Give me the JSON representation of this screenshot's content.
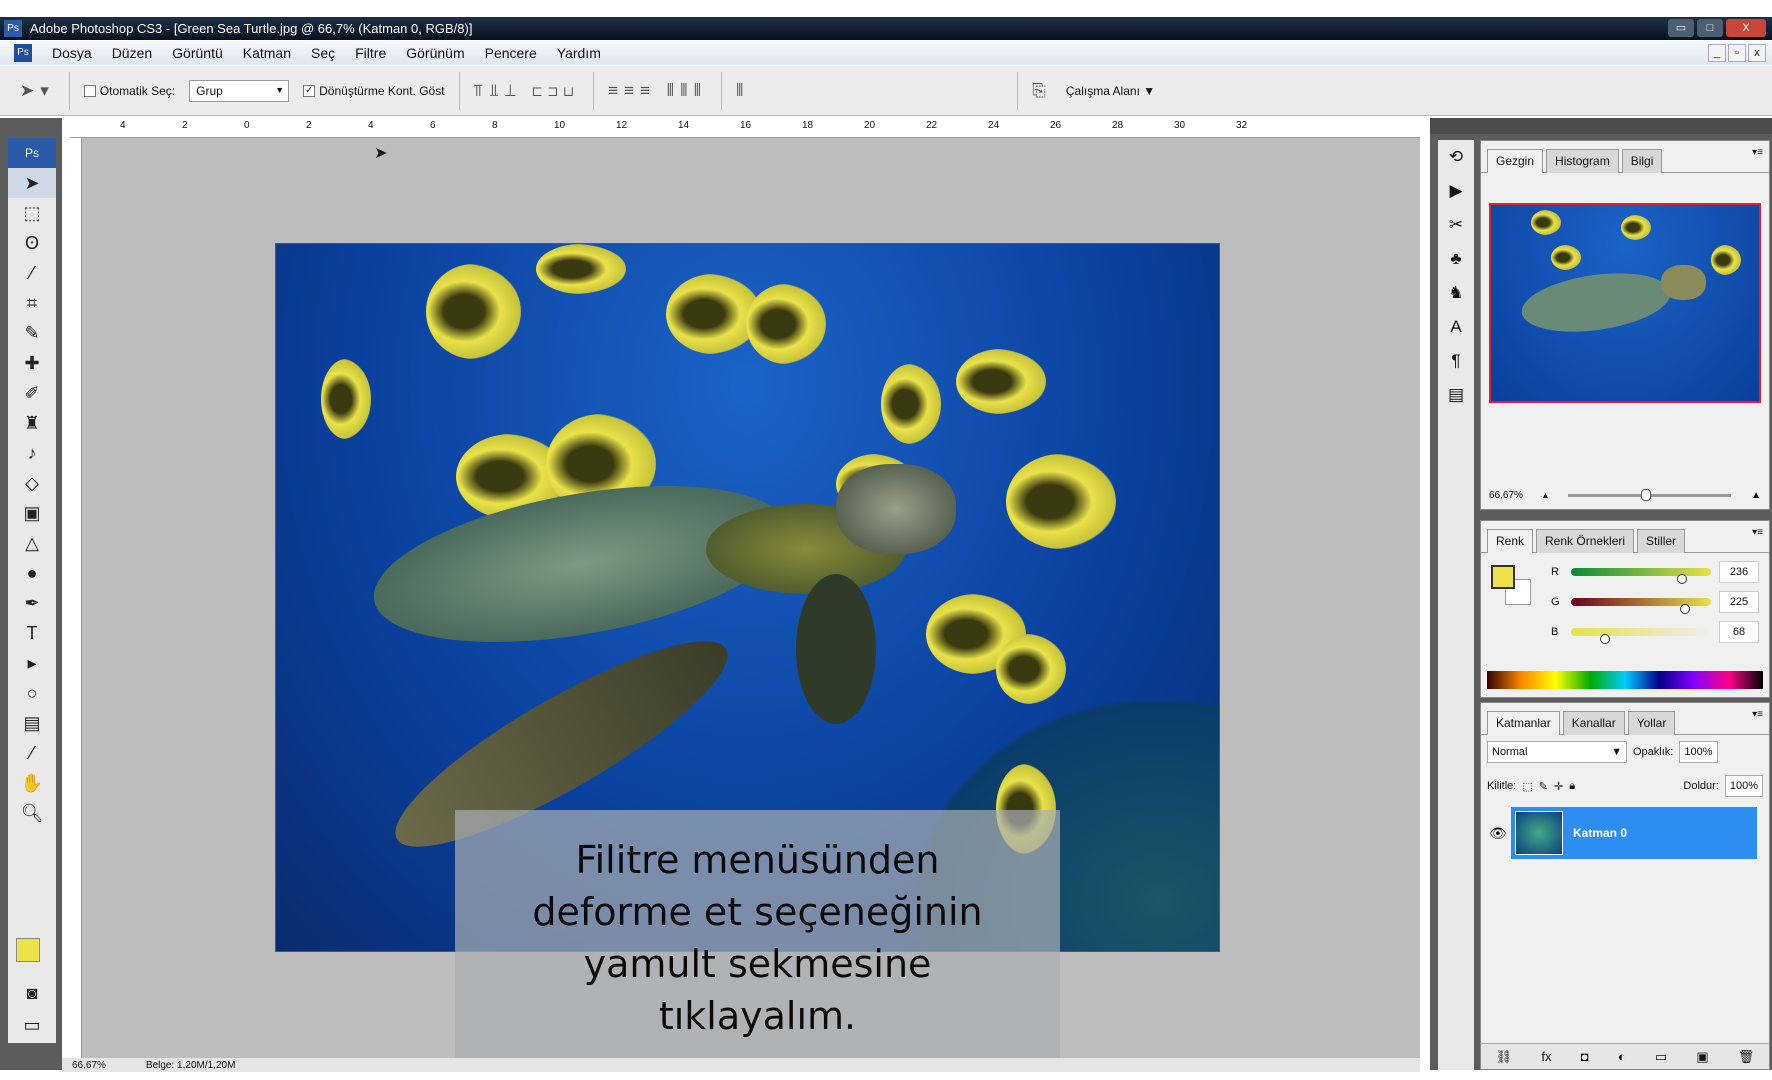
{
  "window": {
    "title": "Adobe Photoshop CS3 - [Green Sea Turtle.jpg @ 66,7% (Katman 0, RGB/8)]",
    "app_icon": "Ps",
    "min": "▭",
    "max": "□",
    "close": "X"
  },
  "menu": [
    "Dosya",
    "Düzen",
    "Görüntü",
    "Katman",
    "Seç",
    "Filtre",
    "Görünüm",
    "Pencere",
    "Yardım"
  ],
  "doc_controls": {
    "min": "_",
    "restore": "▫",
    "close": "x"
  },
  "options": {
    "auto_select_label": "Otomatik Seç:",
    "auto_select_value": "Grup",
    "show_transform_label": "Dönüştürme Kont. Göst",
    "workspace_label": "Çalışma Alanı"
  },
  "ruler_labels": [
    "4",
    "2",
    "0",
    "2",
    "4",
    "6",
    "8",
    "10",
    "12",
    "14",
    "16",
    "18",
    "20",
    "22",
    "24",
    "26",
    "28",
    "30",
    "32"
  ],
  "caption": [
    "Filitre menüsünden",
    "deforme et seçeneğinin",
    "yamult sekmesine",
    "tıklayalım."
  ],
  "status": {
    "zoom": "66,67%",
    "doc": "Belge: 1,20M/1,20M"
  },
  "navigator": {
    "tabs": [
      "Gezgin",
      "Histogram",
      "Bilgi"
    ],
    "zoom": "66,67%"
  },
  "color": {
    "tabs": [
      "Renk",
      "Renk Örnekleri",
      "Stiller"
    ],
    "channels": [
      {
        "label": "R",
        "value": "236",
        "pct": 0.8
      },
      {
        "label": "G",
        "value": "225",
        "pct": 0.82
      },
      {
        "label": "B",
        "value": "68",
        "pct": 0.25
      }
    ],
    "foreground": "#ece148",
    "background": "#ffffff"
  },
  "layers": {
    "tabs": [
      "Katmanlar",
      "Kanallar",
      "Yollar"
    ],
    "blend": "Normal",
    "opacity_label": "Opaklık:",
    "opacity": "100%",
    "lock_label": "Kilitle:",
    "fill_label": "Doldur:",
    "fill": "100%",
    "items": [
      {
        "name": "Katman 0"
      }
    ]
  }
}
